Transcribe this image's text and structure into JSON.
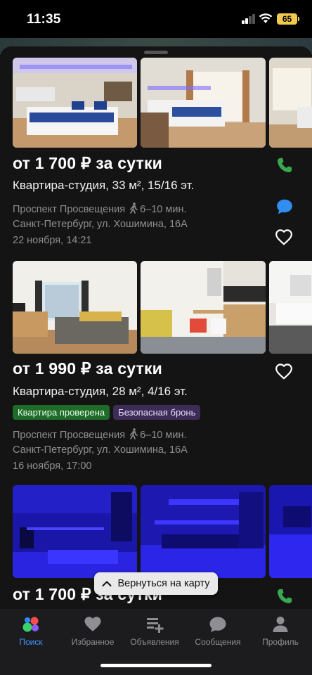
{
  "status": {
    "time": "11:35",
    "battery": "65"
  },
  "listings": [
    {
      "price": "от 1 700 ₽ за сутки",
      "subtitle": "Квартира-студия, 33 м², 15/16 эт.",
      "metro": "Проспект Просвещения",
      "walk": "6–10 мин.",
      "address": "Санкт-Петербург, ул. Хошимина, 16А",
      "date": "22 ноября, 14:21"
    },
    {
      "price": "от 1 990 ₽ за сутки",
      "subtitle": "Квартира-студия, 28 м², 4/16 эт.",
      "badges": [
        "Квартира проверена",
        "Безопасная бронь"
      ],
      "metro": "Проспект Просвещения",
      "walk": "6–10 мин.",
      "address": "Санкт-Петербург, ул. Хошимина, 16А",
      "date": "16 ноября, 17:00"
    },
    {
      "price": "от 1 700 ₽ за сутки"
    }
  ],
  "back_to_map": "Вернуться на карту",
  "tabs": [
    {
      "label": "Поиск",
      "icon": "search-dots-icon",
      "active": true
    },
    {
      "label": "Избранное",
      "icon": "heart-icon"
    },
    {
      "label": "Объявления",
      "icon": "post-ad-icon"
    },
    {
      "label": "Сообщения",
      "icon": "chat-icon"
    },
    {
      "label": "Профиль",
      "icon": "profile-icon"
    }
  ],
  "colors": {
    "accent": "#3a95ff",
    "phone": "#3aa84f",
    "chat": "#2f8ef0",
    "badge_green": "#1f6b2a",
    "badge_purple": "#3d2c55"
  }
}
